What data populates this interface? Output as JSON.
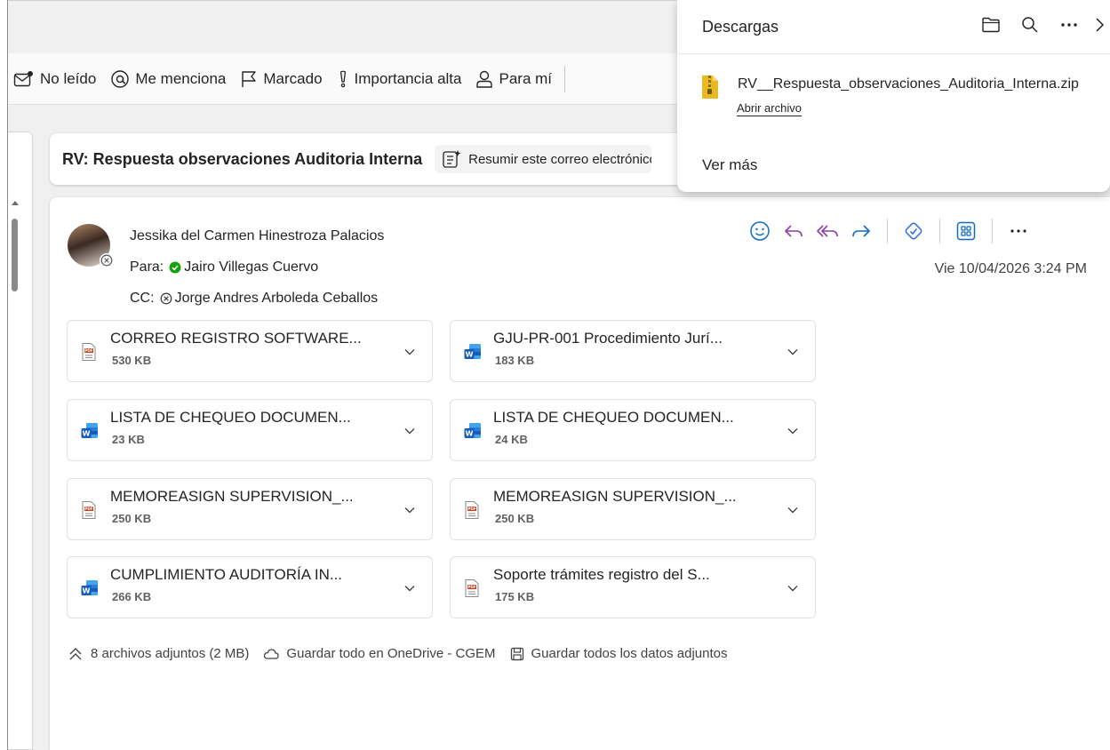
{
  "filters": {
    "unread": "No leído",
    "mentions": "Me menciona",
    "flagged": "Marcado",
    "important": "Importancia alta",
    "to_me": "Para mí"
  },
  "email": {
    "subject": "RV: Respuesta observaciones Auditoria Interna",
    "summarize_label": "Resumir este correo electrónico",
    "sender": "Jessika del Carmen Hinestroza Palacios",
    "to_label": "Para:",
    "to": "Jairo Villegas Cuervo",
    "cc_label": "CC:",
    "cc": "Jorge Andres Arboleda Ceballos",
    "date": "Vie 10/04/2026 3:24 PM"
  },
  "attachments": [
    {
      "name": "CORREO REGISTRO SOFTWARE...",
      "size": "530 KB",
      "type": "pdf"
    },
    {
      "name": "GJU-PR-001 Procedimiento Jurí...",
      "size": "183 KB",
      "type": "word"
    },
    {
      "name": "LISTA DE CHEQUEO DOCUMEN...",
      "size": "23 KB",
      "type": "word"
    },
    {
      "name": "LISTA DE CHEQUEO DOCUMEN...",
      "size": "24 KB",
      "type": "word"
    },
    {
      "name": "MEMOREASIGN SUPERVISION_...",
      "size": "250 KB",
      "type": "pdf"
    },
    {
      "name": "MEMOREASIGN SUPERVISION_...",
      "size": "250 KB",
      "type": "pdf"
    },
    {
      "name": "CUMPLIMIENTO AUDITORÍA IN...",
      "size": "266 KB",
      "type": "word"
    },
    {
      "name": "Soporte trámites registro del S...",
      "size": "175 KB",
      "type": "pdf"
    }
  ],
  "attachments_footer": {
    "count": "8 archivos adjuntos (2 MB)",
    "save_onedrive": "Guardar todo en OneDrive - CGEM",
    "save_all": "Guardar todos los datos adjuntos"
  },
  "downloads": {
    "title": "Descargas",
    "file_name": "RV__Respuesta_observaciones_Auditoria_Interna.zip",
    "open_file": "Abrir archivo",
    "see_more": "Ver más"
  },
  "colors": {
    "accent": "#0f6cbd",
    "reply": "#8a3ca8",
    "copilot": "#3b73d9",
    "presence_green": "#13a10e",
    "pdf_red": "#c43e1c",
    "word_blue": "#185abd",
    "zip_yellow": "#e8b923"
  }
}
